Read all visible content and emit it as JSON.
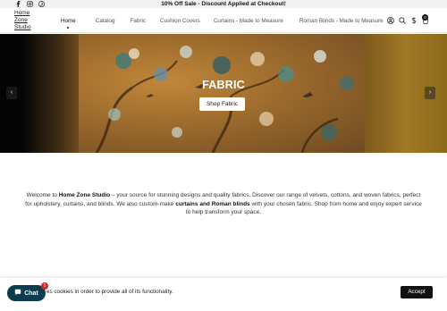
{
  "topbar": {
    "promo": "10% Off Sale - Discount Applied at Checkout!",
    "social_icons": [
      "facebook-icon",
      "instagram-icon",
      "pinterest-icon"
    ]
  },
  "header": {
    "logo_lines": [
      "Home",
      "Zone",
      "Studio"
    ],
    "nav": [
      {
        "label": "Home",
        "active": true
      },
      {
        "label": "Catalog",
        "active": false
      },
      {
        "label": "Fabric",
        "active": false
      },
      {
        "label": "Cushion Covers",
        "active": false
      },
      {
        "label": "Curtains - Made to Measure",
        "active": false
      },
      {
        "label": "Roman Blinds - Made to Measure",
        "active": false
      }
    ],
    "icons": [
      "account-icon",
      "search-icon",
      "currency-icon",
      "cart-icon"
    ],
    "cart_count": "0"
  },
  "hero": {
    "title": "FABRIC",
    "button_label": "Shop Fabric",
    "prev_arrow": "‹",
    "next_arrow": "›"
  },
  "welcome": {
    "prefix": "Welcome to ",
    "brand": "Home Zone Studio",
    "part1": " – your source for stunning designs and quality fabrics. Discover our range of velvets, cottons, and woven fabrics, perfect for upholstery, curtains, and blinds. We also custom-make ",
    "highlight": "curtains and Roman blinds",
    "part2": " with your chosen fabric. Shop from home and enjoy expert service to help transform your space."
  },
  "cookie": {
    "text": "es cookies in order to provide all of its functionality.",
    "accept_label": "Accept"
  },
  "chat": {
    "label": "Chat",
    "badge": "1"
  },
  "colors": {
    "topbar_bg": "#f2f2f2",
    "hero_mustard": "#a17826",
    "chat_bg": "#0a3b4f",
    "badge_red": "#d8232a",
    "accept_bg": "#111111"
  }
}
